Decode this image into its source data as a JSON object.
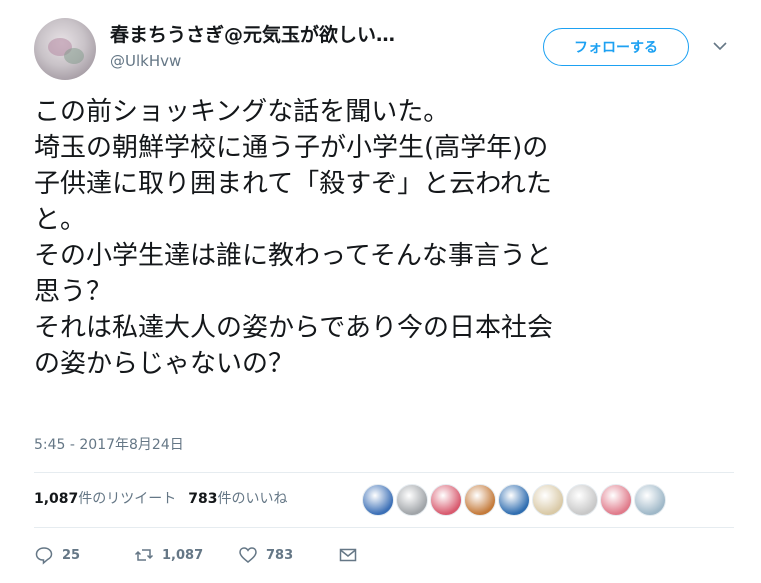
{
  "author": {
    "display_name": "春まちうさぎ@元気玉が欲しい…",
    "handle": "@UlkHvw"
  },
  "follow_button": "フォローする",
  "tweet": {
    "text": "この前ショッキングな話を聞いた。\n埼玉の朝鮮学校に通う子が小学生(高学年)の\n子供達に取り囲まれて「殺すぞ」と云われた\nと。\nその小学生達は誰に教わってそんな事言うと\n思う？\nそれは私達大人の姿からであり今の日本社会\nの姿からじゃないの？",
    "timestamp": "5:45 - 2017年8月24日"
  },
  "stats": {
    "retweet_count": "1,087",
    "retweet_label": "件のリツイート",
    "like_count": "783",
    "like_label": "件のいいね"
  },
  "actions": {
    "reply_count": "25",
    "retweet_count": "1,087",
    "like_count": "783"
  },
  "liker_avatar_colors": [
    "#3b6fb6",
    "#a0a4a8",
    "#d85a6e",
    "#c47a3a",
    "#2f6db0",
    "#d9c9a6",
    "#c8c8c8",
    "#e07a8a",
    "#9fb8c8"
  ],
  "colors": {
    "accent": "#1da1f2",
    "secondary_text": "#657786",
    "primary_text": "#14171a"
  }
}
